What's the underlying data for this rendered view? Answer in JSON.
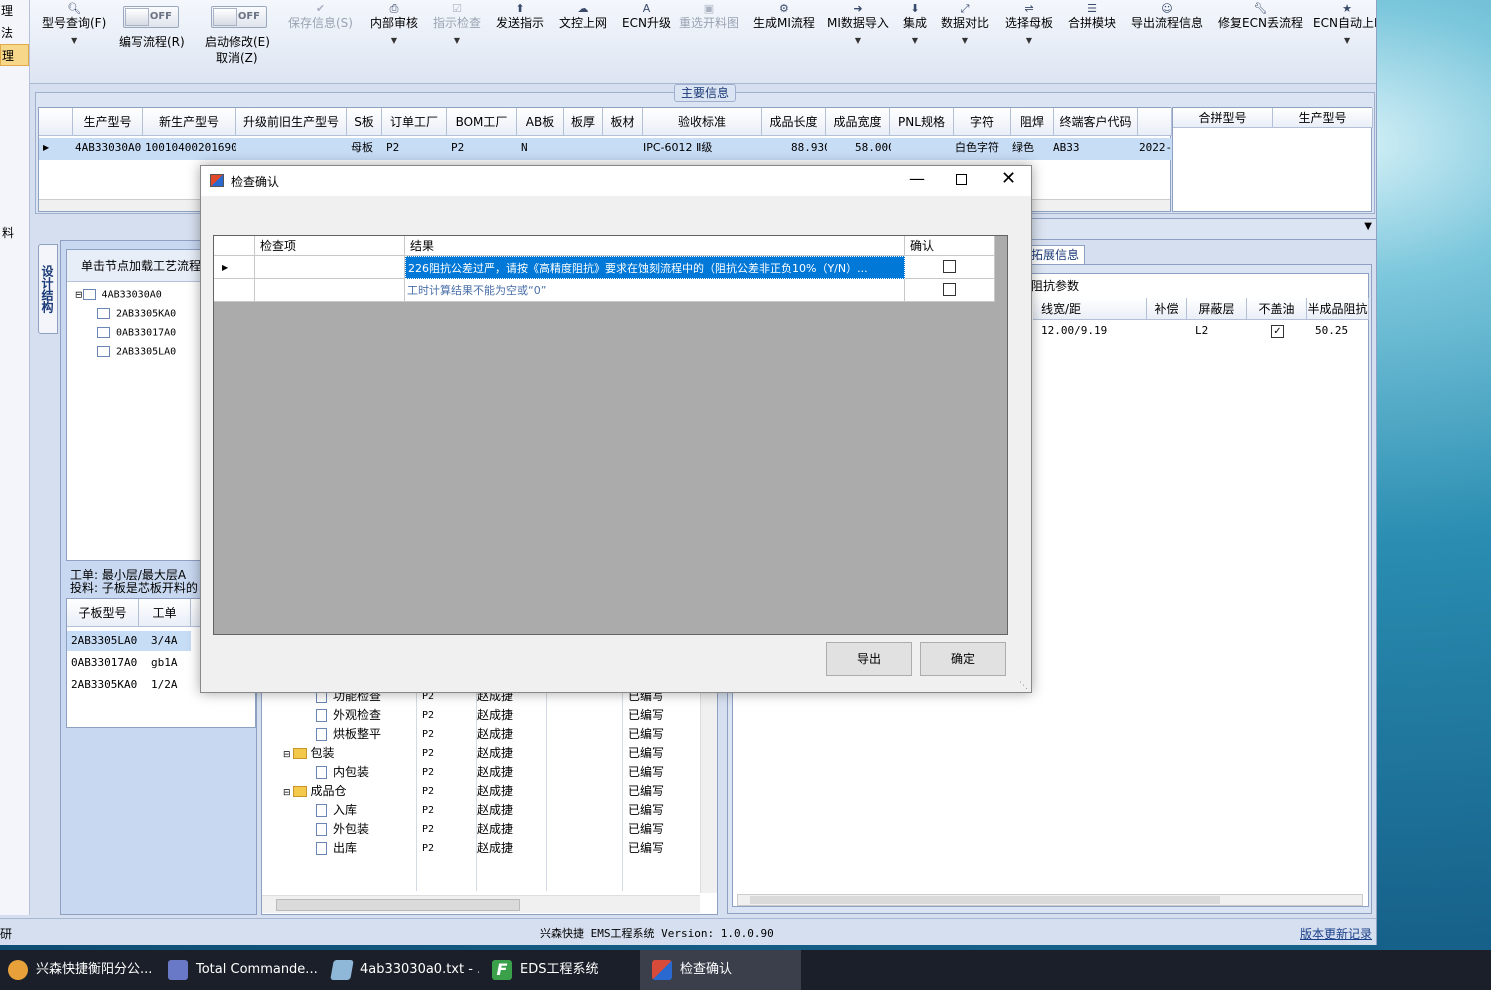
{
  "left_nav": {
    "items": [
      "理",
      "法",
      "理",
      "",
      "",
      "",
      "",
      "",
      "",
      "",
      "料",
      "",
      "",
      "",
      "",
      "",
      "",
      "",
      "",
      "",
      "",
      "",
      "",
      "",
      "",
      "",
      "",
      "",
      "",
      "",
      "",
      "",
      "",
      "",
      "",
      "",
      "",
      "",
      "",
      "",
      "研"
    ]
  },
  "toolbar": {
    "model_query": "型号查询(F)",
    "write_flow_toggle": "OFF",
    "write_flow": "编写流程(R)",
    "auto_modify_toggle": "OFF",
    "auto_modify_1": "启动修改(E)",
    "auto_modify_2": "取消(Z)",
    "save_info": "保存信息(S)",
    "internal_review": "内部审核",
    "indicator_check": "指示检查",
    "send_indicator": "发送指示",
    "file_upload": "文控上网",
    "ecn_upgrade": "ECN升级",
    "reselect_layout": "重选开料图",
    "gen_mi_flow": "生成MI流程",
    "mi_data_import": "MI数据导入",
    "integrate": "集成",
    "data_compare": "数据对比",
    "select_mother": "选择母板",
    "merge_module": "合拼模块",
    "export_flow_info": "导出流程信息",
    "repair_ecn": "修复ECN丢流程",
    "ecn_auto": "ECN自动上P"
  },
  "main_info": {
    "title": "主要信息",
    "columns": [
      "生产型号",
      "新生产型号",
      "升级前旧生产型号",
      "S板",
      "订单工厂",
      "BOM工厂",
      "AB板",
      "板厚",
      "板材",
      "验收标准",
      "成品长度",
      "成品宽度",
      "PNL规格",
      "字符",
      "阻焊",
      "终端客户代码"
    ],
    "row": [
      "4AB33030A0",
      "10010400201690",
      "",
      "母板",
      "P2",
      "P2",
      "N",
      "",
      "",
      "IPC-6012 Ⅱ级",
      "88.930",
      "58.000",
      "",
      "白色字符",
      "绿色",
      "AB33",
      "2022-"
    ],
    "merge_columns": [
      "合拼型号",
      "生产型号"
    ]
  },
  "left_panel": {
    "vertical_tab": "设计结构",
    "header": "单击节点加载工艺流程",
    "tree": [
      "4AB33030A0",
      "2AB3305KA0",
      "0AB33017A0",
      "2AB3305LA0"
    ],
    "info_1": "工单: 最小层/最大层A",
    "info_2": "投料: 子板是芯板开料的",
    "sub_columns": [
      "子板型号",
      "工单"
    ],
    "sub_rows": [
      [
        "2AB3305LA0",
        "3/4A"
      ],
      [
        "0AB33017A0",
        "gb1A"
      ],
      [
        "2AB3305KA0",
        "1/2A"
      ]
    ]
  },
  "process_panel": {
    "rows": [
      {
        "name": "功能检查",
        "factory": "P2",
        "person": "赵成捷",
        "status": "已编写",
        "type": "doc",
        "indent": 2
      },
      {
        "name": "外观检查",
        "factory": "P2",
        "person": "赵成捷",
        "status": "已编写",
        "type": "doc",
        "indent": 2
      },
      {
        "name": "烘板整平",
        "factory": "P2",
        "person": "赵成捷",
        "status": "已编写",
        "type": "doc",
        "indent": 2
      },
      {
        "name": "包装",
        "factory": "P2",
        "person": "赵成捷",
        "status": "已编写",
        "type": "folder",
        "indent": 1
      },
      {
        "name": "内包装",
        "factory": "P2",
        "person": "赵成捷",
        "status": "已编写",
        "type": "doc",
        "indent": 2
      },
      {
        "name": "成品仓",
        "factory": "P2",
        "person": "赵成捷",
        "status": "已编写",
        "type": "folder",
        "indent": 1
      },
      {
        "name": "入库",
        "factory": "P2",
        "person": "赵成捷",
        "status": "已编写",
        "type": "doc",
        "indent": 2
      },
      {
        "name": "外包装",
        "factory": "P2",
        "person": "赵成捷",
        "status": "已编写",
        "type": "doc",
        "indent": 2
      },
      {
        "name": "出库",
        "factory": "P2",
        "person": "赵成捷",
        "status": "已编写",
        "type": "doc",
        "indent": 2
      }
    ]
  },
  "right_panel": {
    "tab": "拓展信息",
    "section": "阻抗参数",
    "columns": [
      "线宽/距",
      "补偿",
      "屏蔽层",
      "不盖油",
      "半成品阻抗"
    ],
    "row": [
      "12.00/9.19",
      "",
      "L2",
      "checked",
      "50.25"
    ]
  },
  "status_bar": {
    "system": "兴森快捷 EMS工程系统 Version: 1.0.0.90",
    "update_link": "版本更新记录"
  },
  "dialog": {
    "title": "检查确认",
    "col_item": "检查项",
    "col_result": "结果",
    "col_confirm": "确认",
    "rows": [
      {
        "item": "",
        "result": "226阻抗公差过严，请按《高精度阻抗》要求在蚀刻流程中的（阻抗公差非正负10%（Y/N）...",
        "confirmed": false
      },
      {
        "item": "",
        "result": "工时计算结果不能为空或“0”",
        "confirmed": false
      }
    ],
    "export_button": "导出",
    "ok_button": "确定"
  },
  "taskbar": {
    "items": [
      {
        "label": "兴森快捷衡阳分公...",
        "color": "#e8a13a"
      },
      {
        "label": "Total Commande...",
        "color": "#6a78c8"
      },
      {
        "label": "4ab33030a0.txt - ...",
        "color": "#8fb7d8"
      },
      {
        "label": "EDS工程系统",
        "color": "#3aa04a"
      },
      {
        "label": "检查确认",
        "color": "#d84a3a"
      }
    ]
  }
}
